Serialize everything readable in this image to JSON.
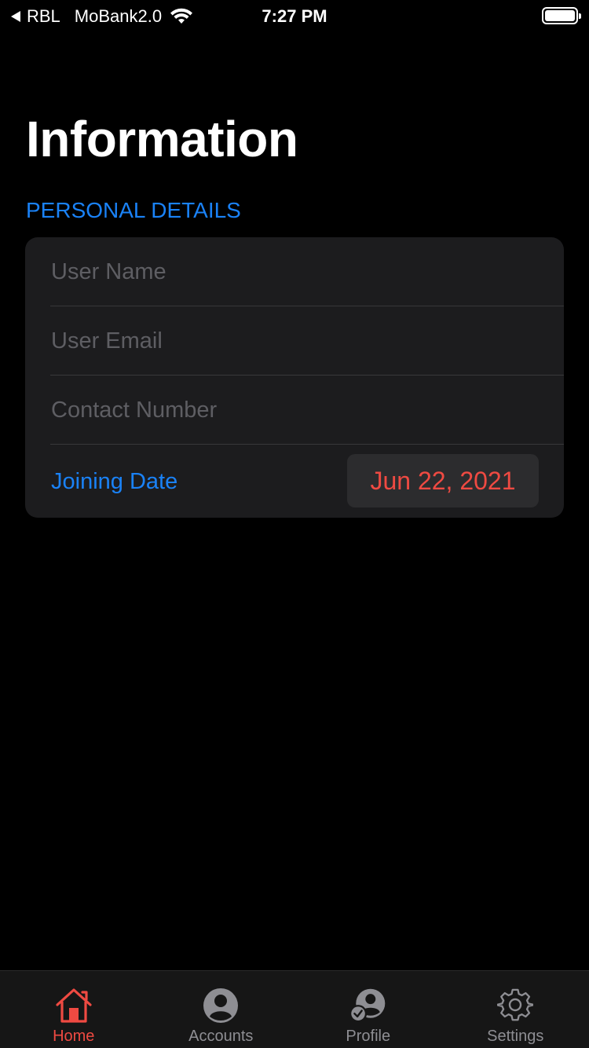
{
  "status_bar": {
    "back_app": "RBL",
    "carrier": "MoBank2.0",
    "time": "7:27 PM",
    "battery_level": 1.0
  },
  "page": {
    "title": "Information"
  },
  "personal_details": {
    "section_header": "PERSONAL DETAILS",
    "user_name": {
      "value": "",
      "placeholder": "User Name"
    },
    "user_email": {
      "value": "",
      "placeholder": "User Email"
    },
    "contact_number": {
      "value": "",
      "placeholder": "Contact Number"
    },
    "joining_date": {
      "label": "Joining Date",
      "value": "Jun 22, 2021"
    }
  },
  "tab_bar": {
    "tabs": [
      {
        "label": "Home",
        "icon": "home-icon",
        "active": true
      },
      {
        "label": "Accounts",
        "icon": "person-circle-icon",
        "active": false
      },
      {
        "label": "Profile",
        "icon": "profile-check-icon",
        "active": false
      },
      {
        "label": "Settings",
        "icon": "gear-icon",
        "active": false
      }
    ]
  },
  "colors": {
    "accent_blue": "#1a82f7",
    "accent_red": "#ef4a42",
    "background": "#000000",
    "card": "#1c1c1e",
    "tab_bar": "#161616",
    "inactive_tab": "#8e8e93"
  }
}
